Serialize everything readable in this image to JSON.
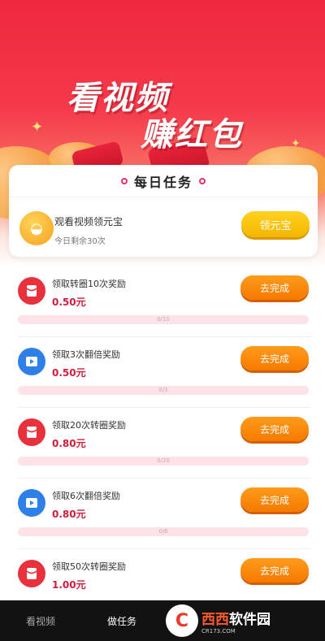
{
  "hero": {
    "title_line1": "看视频",
    "title_line2": "赚红包"
  },
  "daily": {
    "title": "每日任务",
    "item": {
      "name": "观看视频领元宝",
      "sub": "今日剩余30次",
      "button": "领元宝"
    }
  },
  "tasks": [
    {
      "name": "领取转圈10次奖励",
      "reward": "0.50元",
      "button": "去完成",
      "progress_text": "0/10",
      "progress": 0,
      "icon": "red-envelope-icon",
      "icon_color": "#e8313c"
    },
    {
      "name": "领取3次翻倍奖励",
      "reward": "0.50元",
      "button": "去完成",
      "progress_text": "0/3",
      "progress": 0,
      "icon": "video-play-icon",
      "icon_color": "#2e7fe8"
    },
    {
      "name": "领取20次转圈奖励",
      "reward": "0.80元",
      "button": "去完成",
      "progress_text": "0/20",
      "progress": 0,
      "icon": "red-envelope-icon",
      "icon_color": "#e8313c"
    },
    {
      "name": "领取6次翻倍奖励",
      "reward": "0.80元",
      "button": "去完成",
      "progress_text": "0/6",
      "progress": 0,
      "icon": "video-play-icon",
      "icon_color": "#2e7fe8"
    },
    {
      "name": "领取50次转圈奖励",
      "reward": "1.00元",
      "button": "去完成",
      "progress_text": "",
      "progress": 0,
      "icon": "red-envelope-icon",
      "icon_color": "#e8313c"
    }
  ],
  "tabbar": {
    "tab1": "看视频",
    "tab2": "做任务"
  },
  "watermark": {
    "text1": "西西",
    "text2": "软件园",
    "sub": "CR173.COM"
  },
  "colors": {
    "accent_red": "#f0283f",
    "button_orange": "#f57a00",
    "button_yellow": "#f4b600",
    "reward_red": "#d11b3b"
  }
}
